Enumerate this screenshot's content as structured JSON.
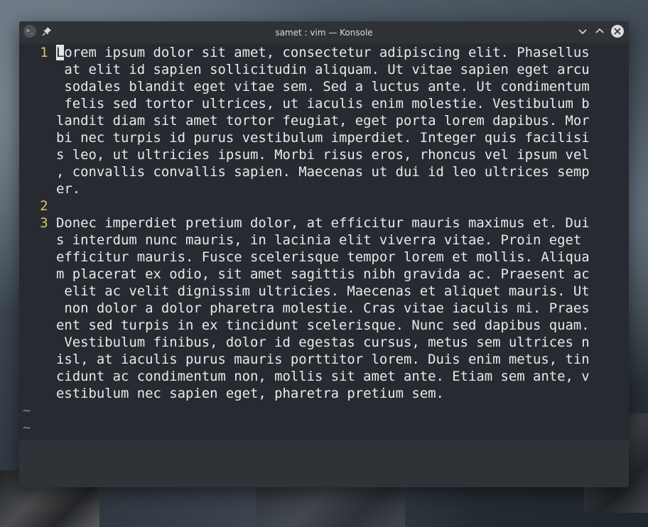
{
  "window": {
    "title": "samet : vim — Konsole"
  },
  "titlebar": {
    "app_icon_text": ">_",
    "icons": [
      "terminal-icon",
      "pin-icon",
      "minimize-chevron-icon",
      "maximize-chevron-icon",
      "close-icon"
    ]
  },
  "editor": {
    "lines": [
      {
        "num": "1",
        "text": "Lorem ipsum dolor sit amet, consectetur adipiscing elit. Phasellus"
      },
      {
        "num": "",
        "text": " at elit id sapien sollicitudin aliquam. Ut vitae sapien eget arcu"
      },
      {
        "num": "",
        "text": " sodales blandit eget vitae sem. Sed a luctus ante. Ut condimentum"
      },
      {
        "num": "",
        "text": " felis sed tortor ultrices, ut iaculis enim molestie. Vestibulum b"
      },
      {
        "num": "",
        "text": "landit diam sit amet tortor feugiat, eget porta lorem dapibus. Mor"
      },
      {
        "num": "",
        "text": "bi nec turpis id purus vestibulum imperdiet. Integer quis facilisi"
      },
      {
        "num": "",
        "text": "s leo, ut ultricies ipsum. Morbi risus eros, rhoncus vel ipsum vel"
      },
      {
        "num": "",
        "text": ", convallis convallis sapien. Maecenas ut dui id leo ultrices semp"
      },
      {
        "num": "",
        "text": "er."
      },
      {
        "num": "2",
        "text": ""
      },
      {
        "num": "3",
        "text": "Donec imperdiet pretium dolor, at efficitur mauris maximus et. Dui"
      },
      {
        "num": "",
        "text": "s interdum nunc mauris, in lacinia elit viverra vitae. Proin eget "
      },
      {
        "num": "",
        "text": "efficitur mauris. Fusce scelerisque tempor lorem et mollis. Aliqua"
      },
      {
        "num": "",
        "text": "m placerat ex odio, sit amet sagittis nibh gravida ac. Praesent ac"
      },
      {
        "num": "",
        "text": " elit ac velit dignissim ultricies. Maecenas et aliquet mauris. Ut"
      },
      {
        "num": "",
        "text": " non dolor a dolor pharetra molestie. Cras vitae iaculis mi. Praes"
      },
      {
        "num": "",
        "text": "ent sed turpis in ex tincidunt scelerisque. Nunc sed dapibus quam."
      },
      {
        "num": "",
        "text": " Vestibulum finibus, dolor id egestas cursus, metus sem ultrices n"
      },
      {
        "num": "",
        "text": "isl, at iaculis purus mauris porttitor lorem. Duis enim metus, tin"
      },
      {
        "num": "",
        "text": "cidunt ac condimentum non, mollis sit amet ante. Etiam sem ante, v"
      },
      {
        "num": "",
        "text": "estibulum nec sapien eget, pharetra pretium sem."
      }
    ],
    "tildes": [
      "~",
      "~",
      "~"
    ],
    "cursor": {
      "line": 0,
      "col": 0
    },
    "colors": {
      "background": "#272b31",
      "text": "#e9e9e9",
      "line_number": "#e0c15e",
      "tilde": "#5a8ec9"
    }
  }
}
